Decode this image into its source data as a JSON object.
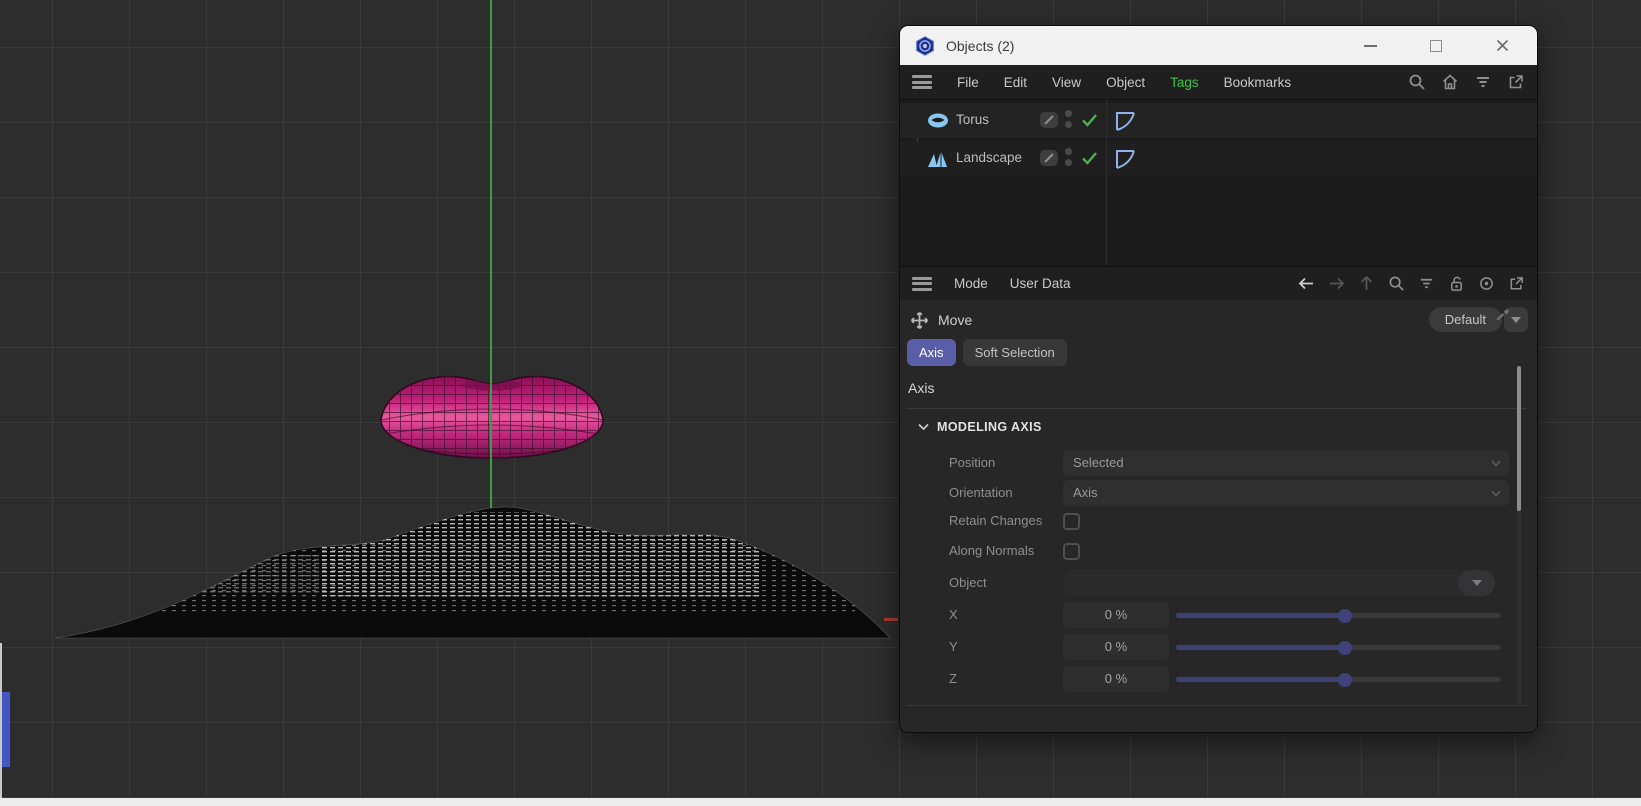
{
  "window": {
    "title": "Objects (2)"
  },
  "menu": {
    "items": [
      {
        "label": "File"
      },
      {
        "label": "Edit"
      },
      {
        "label": "View"
      },
      {
        "label": "Object"
      },
      {
        "label": "Tags",
        "highlighted": true
      },
      {
        "label": "Bookmarks"
      }
    ]
  },
  "objects": {
    "rows": [
      {
        "name": "Torus",
        "icon": "torus-icon",
        "enabled": true,
        "tag": "phong-tag"
      },
      {
        "name": "Landscape",
        "icon": "landscape-icon",
        "enabled": true,
        "tag": "phong-tag"
      }
    ]
  },
  "attributes": {
    "menus": [
      {
        "label": "Mode"
      },
      {
        "label": "User Data"
      }
    ],
    "tool": {
      "label": "Move"
    },
    "preset": {
      "label": "Default"
    },
    "tabs": [
      {
        "label": "Axis",
        "active": true
      },
      {
        "label": "Soft Selection",
        "active": false
      }
    ],
    "heading": "Axis",
    "group": {
      "title": "MODELING AXIS",
      "collapsed": false
    },
    "fields": {
      "position": {
        "label": "Position",
        "value": "Selected"
      },
      "orientation": {
        "label": "Orientation",
        "value": "Axis"
      },
      "retain_changes": {
        "label": "Retain Changes",
        "checked": false
      },
      "along_normals": {
        "label": "Along Normals",
        "checked": false
      },
      "object": {
        "label": "Object",
        "value": ""
      }
    },
    "sliders": [
      {
        "label": "X",
        "value": "0 %"
      },
      {
        "label": "Y",
        "value": "0 %"
      },
      {
        "label": "Z",
        "value": "0 %"
      }
    ]
  },
  "viewport": {
    "scene_objects": [
      "Torus",
      "Landscape"
    ],
    "colors": {
      "background": "#2d2d2d",
      "grid": "#3a3a3c",
      "torus": "#d63384",
      "y_axis_green": "#3f9e44",
      "x_axis_red": "#a83c32",
      "blue_bar": "#4356c4"
    }
  },
  "icons": {
    "search": "magnifier",
    "home": "house",
    "filter": "funnel-lines",
    "open-external": "box-arrow",
    "back": "arrow-left",
    "forward": "arrow-right",
    "up": "arrow-up",
    "unlock": "open-padlock",
    "target": "record-circle",
    "move": "four-way-arrows",
    "menu": "hamburger",
    "minimize": "dash",
    "maximize": "square",
    "close": "cross"
  },
  "colors": {
    "active_tab": "#5a5ea9",
    "tags_menu_green": "#3fc24c",
    "slider_fill": "#3d4274",
    "check_green": "#4db050",
    "object_icon_blue": "#8ac6f2"
  }
}
